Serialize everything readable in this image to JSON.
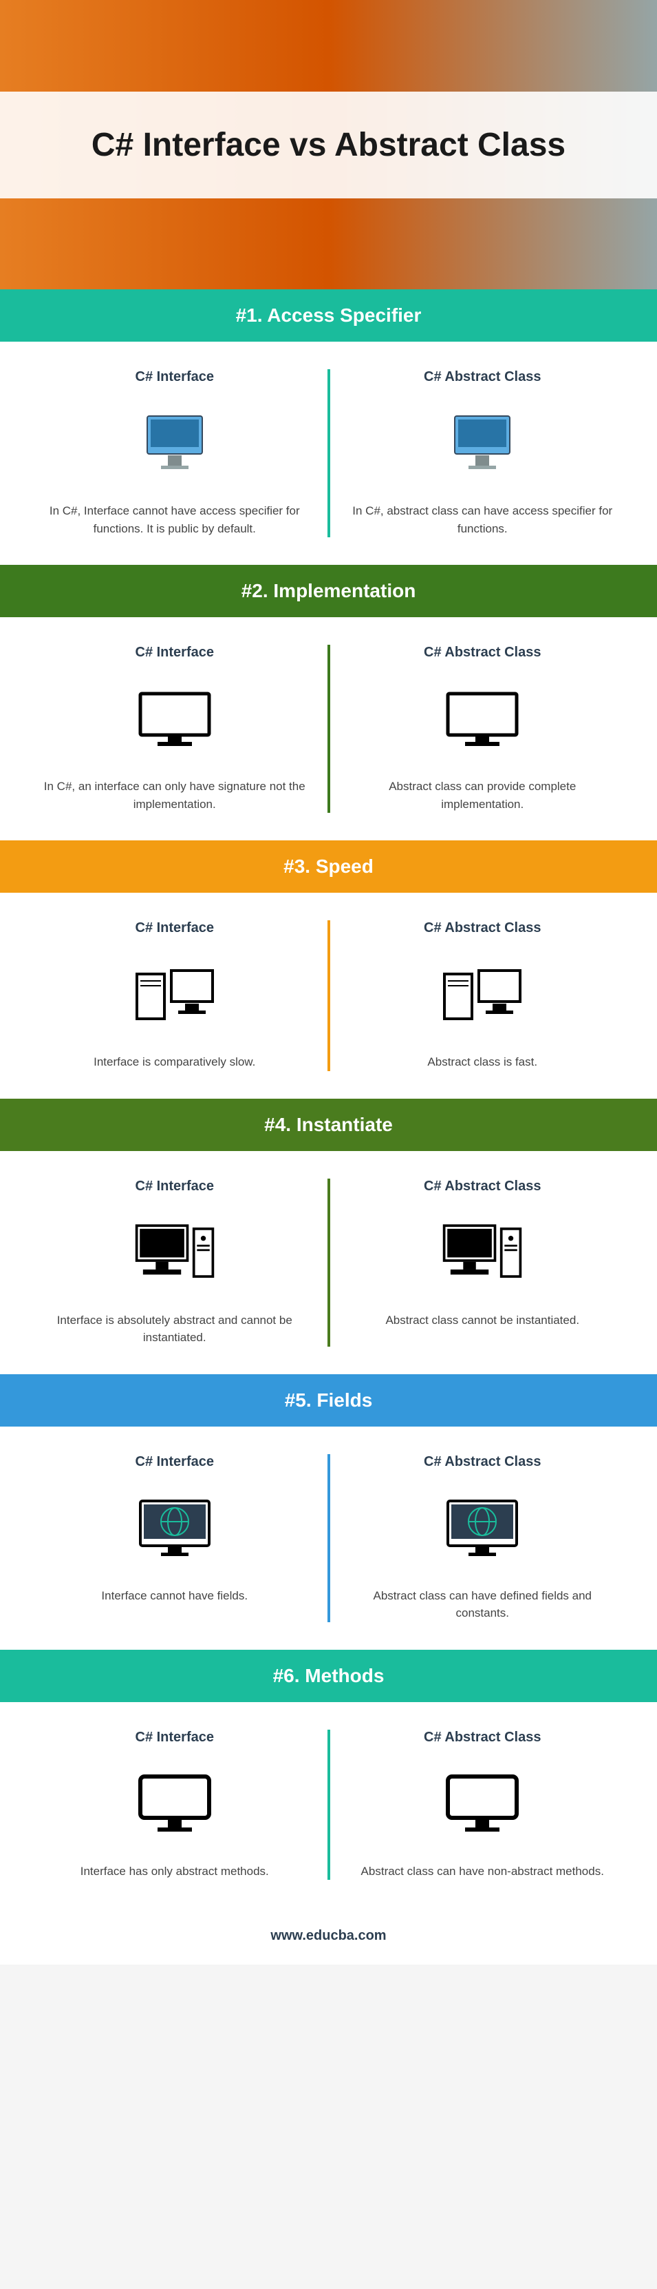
{
  "hero": {
    "title": "C# Interface vs Abstract Class"
  },
  "sections": [
    {
      "header": "#1. Access Specifier",
      "left_title": "C# Interface",
      "right_title": "C# Abstract Class",
      "left_text": "In C#, Interface cannot have access specifier for functions. It is public by default.",
      "right_text": "In C#, abstract class can have access specifier for functions."
    },
    {
      "header": "#2. Implementation",
      "left_title": "C# Interface",
      "right_title": "C# Abstract Class",
      "left_text": "In C#, an interface can only have signature not the implementation.",
      "right_text": "Abstract class can provide complete implementation."
    },
    {
      "header": "#3. Speed",
      "left_title": "C# Interface",
      "right_title": "C# Abstract Class",
      "left_text": "Interface is comparatively slow.",
      "right_text": "Abstract class is fast."
    },
    {
      "header": "#4. Instantiate",
      "left_title": "C# Interface",
      "right_title": "C# Abstract Class",
      "left_text": "Interface is absolutely abstract and cannot be instantiated.",
      "right_text": "Abstract class cannot be instantiated."
    },
    {
      "header": "#5. Fields",
      "left_title": "C# Interface",
      "right_title": "C# Abstract Class",
      "left_text": "Interface cannot have fields.",
      "right_text": "Abstract class can have defined fields and constants."
    },
    {
      "header": "#6. Methods",
      "left_title": "C# Interface",
      "right_title": "C# Abstract Class",
      "left_text": "Interface has only abstract methods.",
      "right_text": "Abstract class can have non-abstract methods."
    }
  ],
  "footer": {
    "url": "www.educba.com"
  },
  "icons": {
    "imac": "imac-icon",
    "monitor": "monitor-icon",
    "servers": "servers-icon",
    "desktop": "desktop-icon",
    "globe": "globe-monitor-icon",
    "monitor2": "monitor-icon"
  }
}
